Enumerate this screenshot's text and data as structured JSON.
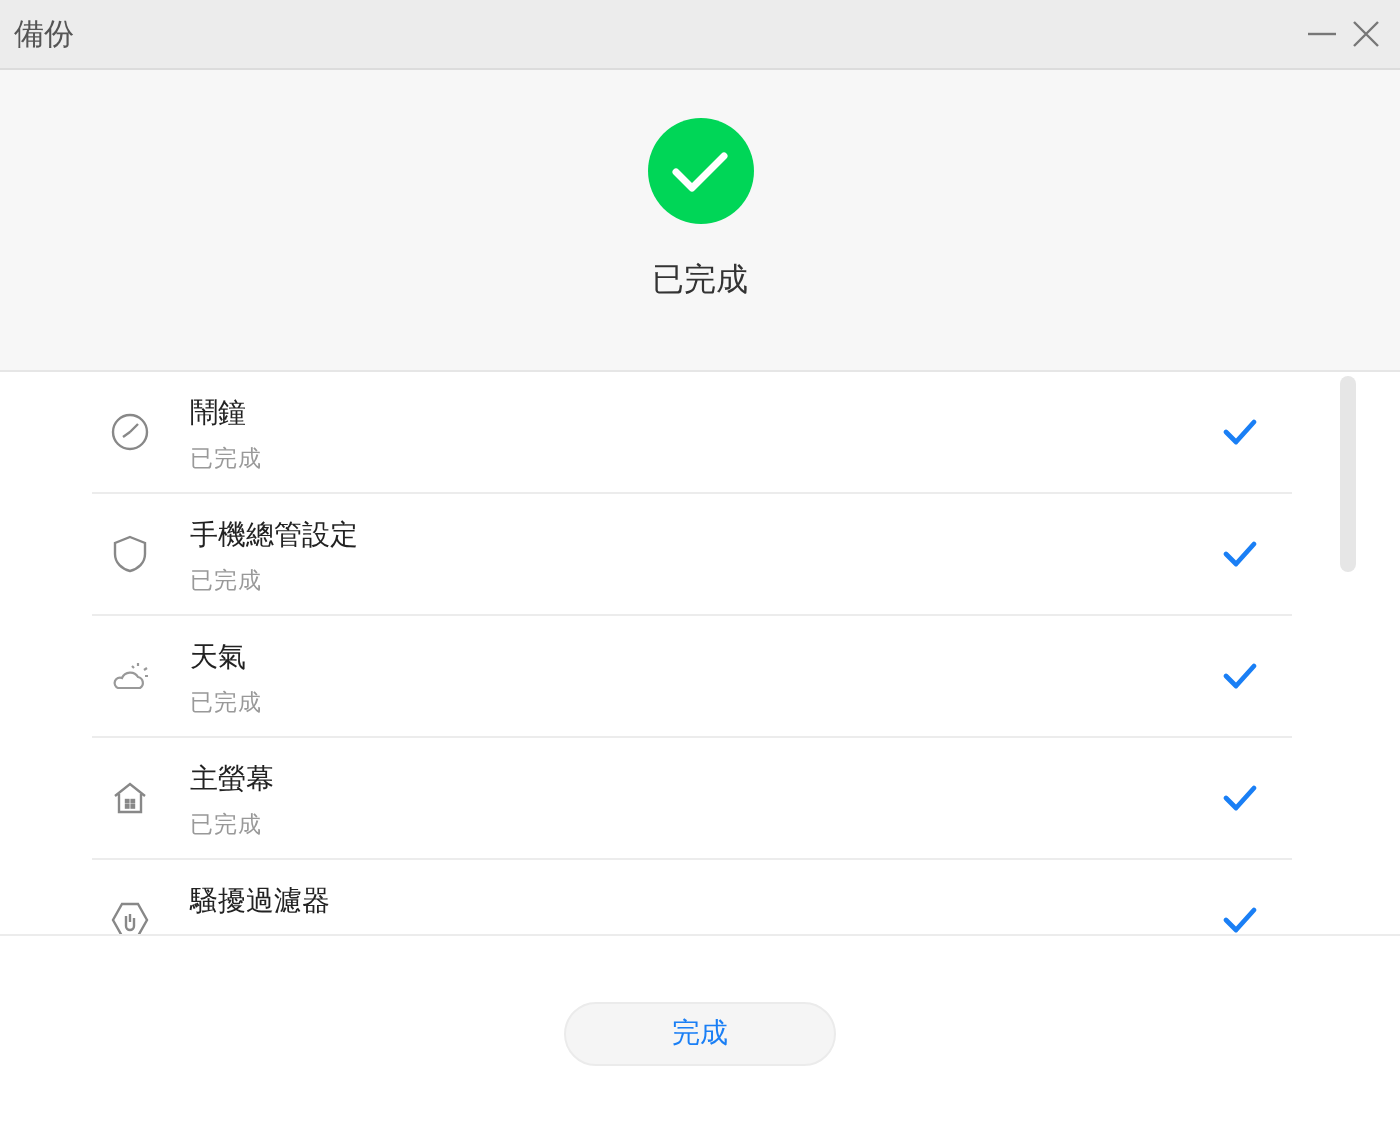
{
  "window": {
    "title": "備份"
  },
  "header": {
    "status": "已完成",
    "done": true
  },
  "items": [
    {
      "kind": "alarm",
      "name": "鬧鐘",
      "status": "已完成",
      "done": true
    },
    {
      "kind": "shield",
      "name": "手機總管設定",
      "status": "已完成",
      "done": true
    },
    {
      "kind": "weather",
      "name": "天氣",
      "status": "已完成",
      "done": true
    },
    {
      "kind": "home",
      "name": "主螢幕",
      "status": "已完成",
      "done": true
    },
    {
      "kind": "filter",
      "name": "騷擾過濾器",
      "done": true
    }
  ],
  "button": "完成"
}
